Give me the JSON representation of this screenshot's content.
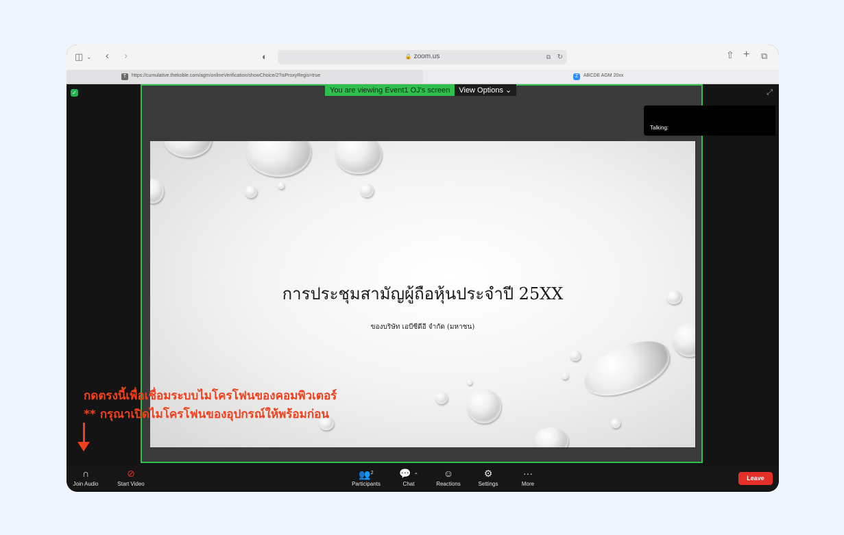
{
  "browser": {
    "url": "zoom.us",
    "tabs": [
      {
        "title": "https://cumulative.thekoble.com/agm/onlineVerification/showChoice/2?isProxyRegis=true",
        "favicon": "T"
      },
      {
        "title": "ABCDE AGM 20xx",
        "favicon": "Z"
      }
    ]
  },
  "zoom": {
    "banner_viewing": "You are viewing Event1 OJ's screen",
    "view_options": "View Options",
    "talking_label": "Talking:",
    "slide": {
      "title": "การประชุมสามัญผู้ถือหุ้นประจำปี 25XX",
      "subtitle": "ของบริษัท เอบีซีดีอี จำกัด (มหาชน)"
    },
    "annotation": {
      "line1": "กดตรงนี้เพื่อเชื่อมระบบไมโครโฟนของคอมพิวเตอร์",
      "line2": "** กรุณาเปิดไมโครโฟนของอุปกรณ์ให้พร้อมก่อน",
      "color": "#f2401c"
    },
    "toolbar": {
      "join_audio": "Join Audio",
      "start_video": "Start Video",
      "participants": "Participants",
      "participants_count": "2",
      "chat": "Chat",
      "reactions": "Reactions",
      "settings": "Settings",
      "more": "More",
      "leave": "Leave"
    }
  }
}
